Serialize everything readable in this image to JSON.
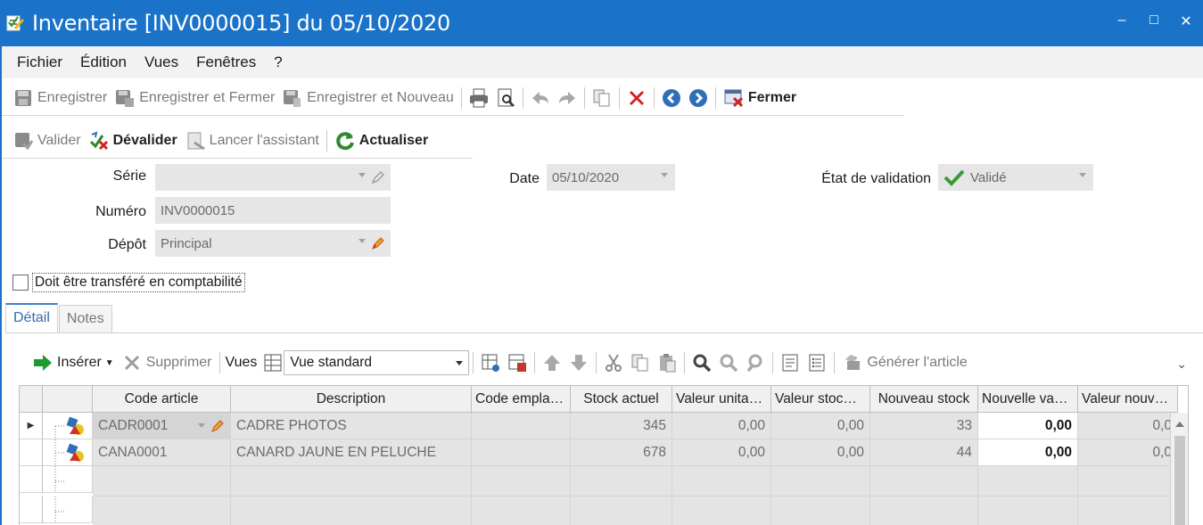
{
  "window": {
    "title": "Inventaire [INV0000015] du 05/10/2020",
    "controls": {
      "minimize": "–",
      "maximize": "□",
      "close": "✕"
    }
  },
  "menu": [
    "Fichier",
    "Édition",
    "Vues",
    "Fenêtres",
    "?"
  ],
  "toolbar1": {
    "save": "Enregistrer",
    "save_close": "Enregistrer et Fermer",
    "save_new": "Enregistrer et Nouveau",
    "close": "Fermer"
  },
  "toolbar2": {
    "validate": "Valider",
    "unvalidate": "Dévalider",
    "wizard": "Lancer l'assistant",
    "refresh": "Actualiser"
  },
  "form": {
    "serie_label": "Série",
    "serie_value": "",
    "numero_label": "Numéro",
    "numero_value": "INV0000015",
    "depot_label": "Dépôt",
    "depot_value": "Principal",
    "date_label": "Date",
    "date_value": "05/10/2020",
    "etat_label": "État de validation",
    "etat_value": "Validé",
    "transfer_label": "Doit être transféré en comptabilité",
    "transfer_checked": false
  },
  "tabs": [
    "Détail",
    "Notes"
  ],
  "grid_toolbar": {
    "insert": "Insérer",
    "delete": "Supprimer",
    "views_label": "Vues",
    "view_value": "Vue standard",
    "generate": "Générer l'article"
  },
  "grid": {
    "columns": [
      "Code article",
      "Description",
      "Code empla…",
      "Stock actuel",
      "Valeur unita…",
      "Valeur stoc…",
      "Nouveau stock",
      "Nouvelle va…",
      "Valeur nouv…"
    ],
    "rows": [
      {
        "code": "CADR0001",
        "description": "CADRE PHOTOS",
        "emplacement": "",
        "stock": "345",
        "valeur_unit": "0,00",
        "valeur_stock": "0,00",
        "nouveau_stock": "33",
        "nouvelle_val": "0,00",
        "valeur_nouv": "0,0"
      },
      {
        "code": "CANA0001",
        "description": "CANARD JAUNE EN PELUCHE",
        "emplacement": "",
        "stock": "678",
        "valeur_unit": "0,00",
        "valeur_stock": "0,00",
        "nouveau_stock": "44",
        "nouvelle_val": "0,00",
        "valeur_nouv": "0,0"
      }
    ]
  }
}
